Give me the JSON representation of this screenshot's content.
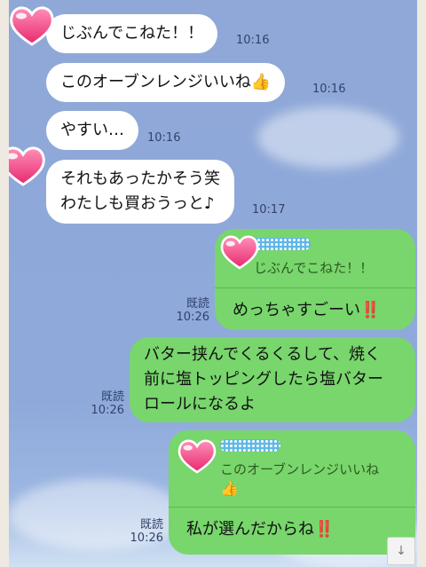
{
  "messages_in": [
    {
      "text": "じぶんでこねた！！",
      "time": "10:16"
    },
    {
      "text": "このオーブンレンジいいね",
      "emoji": "👍",
      "time": "10:16"
    },
    {
      "text": "やすい…",
      "time": "10:16"
    },
    {
      "line1": "それもあったかそう笑",
      "line2": "わたしも買おうっと♪",
      "time": "10:17"
    }
  ],
  "messages_out": [
    {
      "quote": "じぶんでこねた！！",
      "text": "めっちゃすごーい",
      "mark": "‼️",
      "read": "既読",
      "time": "10:26"
    },
    {
      "line1": "バター挟んでくるくるして、焼く",
      "line2": "前に塩トッピングしたら塩バター",
      "line3": "ロールになるよ",
      "read": "既読",
      "time": "10:26"
    },
    {
      "quote": "このオーブンレンジいいね",
      "quote_emoji": "👍",
      "text": "私が選んだからね",
      "mark": "‼️",
      "read": "既読",
      "time": "10:26"
    }
  ],
  "scroll_button": {
    "label": "↓"
  },
  "colors": {
    "incoming": "#ffffff",
    "outgoing": "#78d66c",
    "background": "#8ea9da",
    "heart": "#ff4f8e"
  }
}
